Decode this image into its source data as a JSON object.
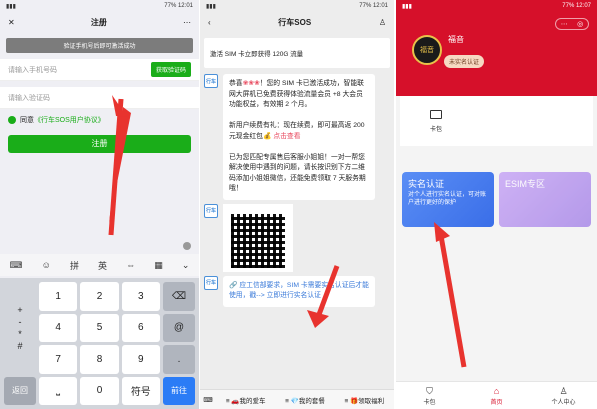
{
  "panel1": {
    "status": {
      "left": "",
      "right": "77% 12:01"
    },
    "title": "注册",
    "notice": "验证手机号后即可激活成功",
    "phone_placeholder": "请输入手机号码",
    "get_code": "获取验证码",
    "code_placeholder": "请输入验证码",
    "agree_prefix": "同意",
    "agree_link": "《行车SOS用户协议》",
    "register": "注册",
    "kb_tools": [
      "拼",
      "英"
    ],
    "keys": [
      "+",
      "1",
      "2",
      "3",
      "-",
      "4",
      "5",
      "6",
      "@",
      "*",
      "7",
      "8",
      "9",
      "#",
      "0",
      "符号",
      "返回",
      "前往"
    ],
    "sym_left": "+\n-\n*\n#"
  },
  "panel2": {
    "status": {
      "right": "77% 12:01"
    },
    "title": "行车SOS",
    "banner": "激活 SIM 卡立即获得 120G 流量",
    "msg1_pre": "恭喜",
    "msg1_body": "！您的 SIM 卡已激活成功，智能联网大屏机已免费获得体验流量会员 +8 大会员功能权益，有效期 2 个月。",
    "msg1_new": "新用户续费有礼：现在续费，即可最高返 200 元现金红包",
    "msg1_link": "点击查看",
    "msg1_end": "已为您匹配专属售后客服小姐姐！一对一帮您解决使用中遇到的问题，请长按识别下方二维码添加小姐姐微信，还能免费领取 7 天服务期哦！",
    "msg2": "应工信部要求，SIM 卡需要实名认证后才能使用，戳--> 立即进行实名认证",
    "qr_caption": "",
    "menu": [
      "我的爱车",
      "我的套餐",
      "领取福利"
    ],
    "avatar_text": "行车"
  },
  "panel3": {
    "status": {
      "right": "77% 12:07"
    },
    "store_name": "福音",
    "auth_tag": "未实名认证",
    "logo_text": "福音",
    "card_label": "卡包",
    "tile1_title": "实名认证",
    "tile1_desc": "对个人进行实名认证，可对账户进行更好的保护",
    "tile2_title": "ESIM专区",
    "tile2_desc": "",
    "tabs": [
      "卡包",
      "首页",
      "个人中心"
    ]
  },
  "colors": {
    "green": "#1aad19",
    "red": "#d6102a",
    "arrow": "#e8332e"
  }
}
